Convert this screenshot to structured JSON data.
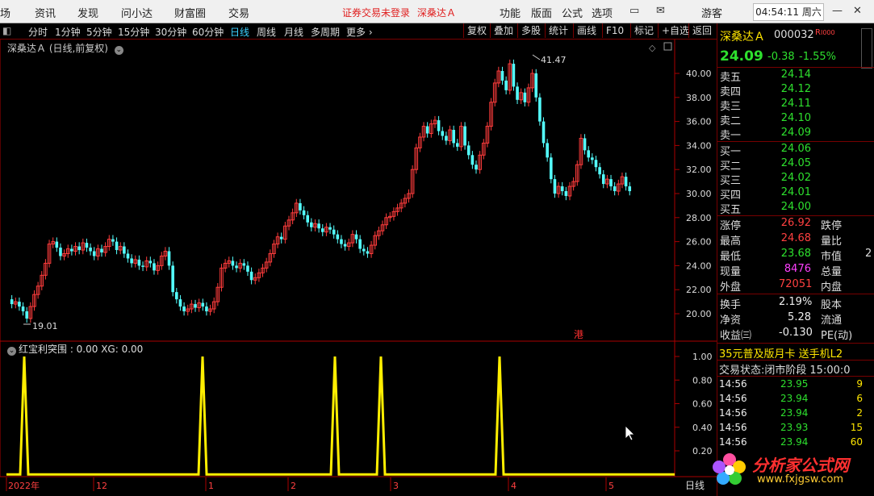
{
  "menu": {
    "items": [
      "场",
      "资讯",
      "发现",
      "问小达",
      "财富圈",
      "交易"
    ],
    "notice": "证券交易未登录",
    "stock_link": "深桑达Ａ",
    "right_items": [
      "功能",
      "版面",
      "公式",
      "选项"
    ],
    "guest": "游客",
    "clock": "04:54:11 周六"
  },
  "toolbar": {
    "periods": [
      "分时",
      "1分钟",
      "5分钟",
      "15分钟",
      "30分钟",
      "60分钟",
      "日线",
      "周线",
      "月线",
      "多周期",
      "更多 ›"
    ],
    "active": "日线",
    "right_buttons": [
      "复权",
      "叠加",
      "多股",
      "统计",
      "画线",
      "F10",
      "标记",
      "+自选",
      "返回"
    ]
  },
  "main_chart": {
    "title": "深桑达Ａ (日线,前复权)",
    "high_label": "41.47",
    "low_label": "19.01",
    "hk_mark": "港",
    "y_ticks": [
      "40.00",
      "38.00",
      "36.00",
      "34.00",
      "32.00",
      "30.00",
      "28.00",
      "26.00",
      "24.00",
      "22.00",
      "20.00"
    ]
  },
  "indicator": {
    "title": "红宝利突围 : 0.00  XG: 0.00",
    "y_ticks": [
      "1.00",
      "0.80",
      "0.60",
      "0.40",
      "0.20"
    ]
  },
  "x_axis": {
    "labels": [
      "2022年",
      "12",
      "1",
      "2",
      "3",
      "4",
      "5"
    ],
    "period_label": "日线"
  },
  "quote": {
    "name": "深桑达Ａ",
    "code": "000032",
    "badge": "R",
    "price": "24.09",
    "change": "-0.38",
    "change_pct": "-1.55%",
    "asks": [
      {
        "label": "卖五",
        "price": "24.14"
      },
      {
        "label": "卖四",
        "price": "24.12"
      },
      {
        "label": "卖三",
        "price": "24.11"
      },
      {
        "label": "卖二",
        "price": "24.10"
      },
      {
        "label": "卖一",
        "price": "24.09"
      }
    ],
    "bids": [
      {
        "label": "买一",
        "price": "24.06"
      },
      {
        "label": "买二",
        "price": "24.05"
      },
      {
        "label": "买三",
        "price": "24.02"
      },
      {
        "label": "买四",
        "price": "24.01"
      },
      {
        "label": "买五",
        "price": "24.00"
      }
    ],
    "stats": [
      {
        "label": "涨停",
        "value": "26.92",
        "label2": "跌停",
        "color": "red"
      },
      {
        "label": "最高",
        "value": "24.68",
        "label2": "量比",
        "color": "red"
      },
      {
        "label": "最低",
        "value": "23.68",
        "label2": "市值",
        "color": "green"
      },
      {
        "label": "现量",
        "value": "8476",
        "label2": "总量",
        "color": "magenta"
      },
      {
        "label": "外盘",
        "value": "72051",
        "label2": "内盘",
        "color": "red"
      }
    ],
    "stats2": [
      {
        "label": "换手",
        "value": "2.19%",
        "label2": "股本"
      },
      {
        "label": "净资",
        "value": "5.28",
        "label2": "流通"
      },
      {
        "label": "收益㈢",
        "value": "-0.130",
        "label2": "PE(动)"
      }
    ],
    "mv_partial": "2",
    "promo": "35元普及版月卡 送手机L2",
    "trade_status_label": "交易状态:",
    "trade_status": "闭市阶段",
    "trade_time": "15:00:0",
    "ticks": [
      {
        "time": "14:56",
        "price": "23.95",
        "vol": "9"
      },
      {
        "time": "14:56",
        "price": "23.94",
        "vol": "6"
      },
      {
        "time": "14:56",
        "price": "23.94",
        "vol": "2"
      },
      {
        "time": "14:56",
        "price": "23.93",
        "vol": "15"
      },
      {
        "time": "14:56",
        "price": "23.94",
        "vol": "60"
      }
    ]
  },
  "watermark": {
    "text": "分析家公式网",
    "url": "www.fxjgsw.com"
  }
}
